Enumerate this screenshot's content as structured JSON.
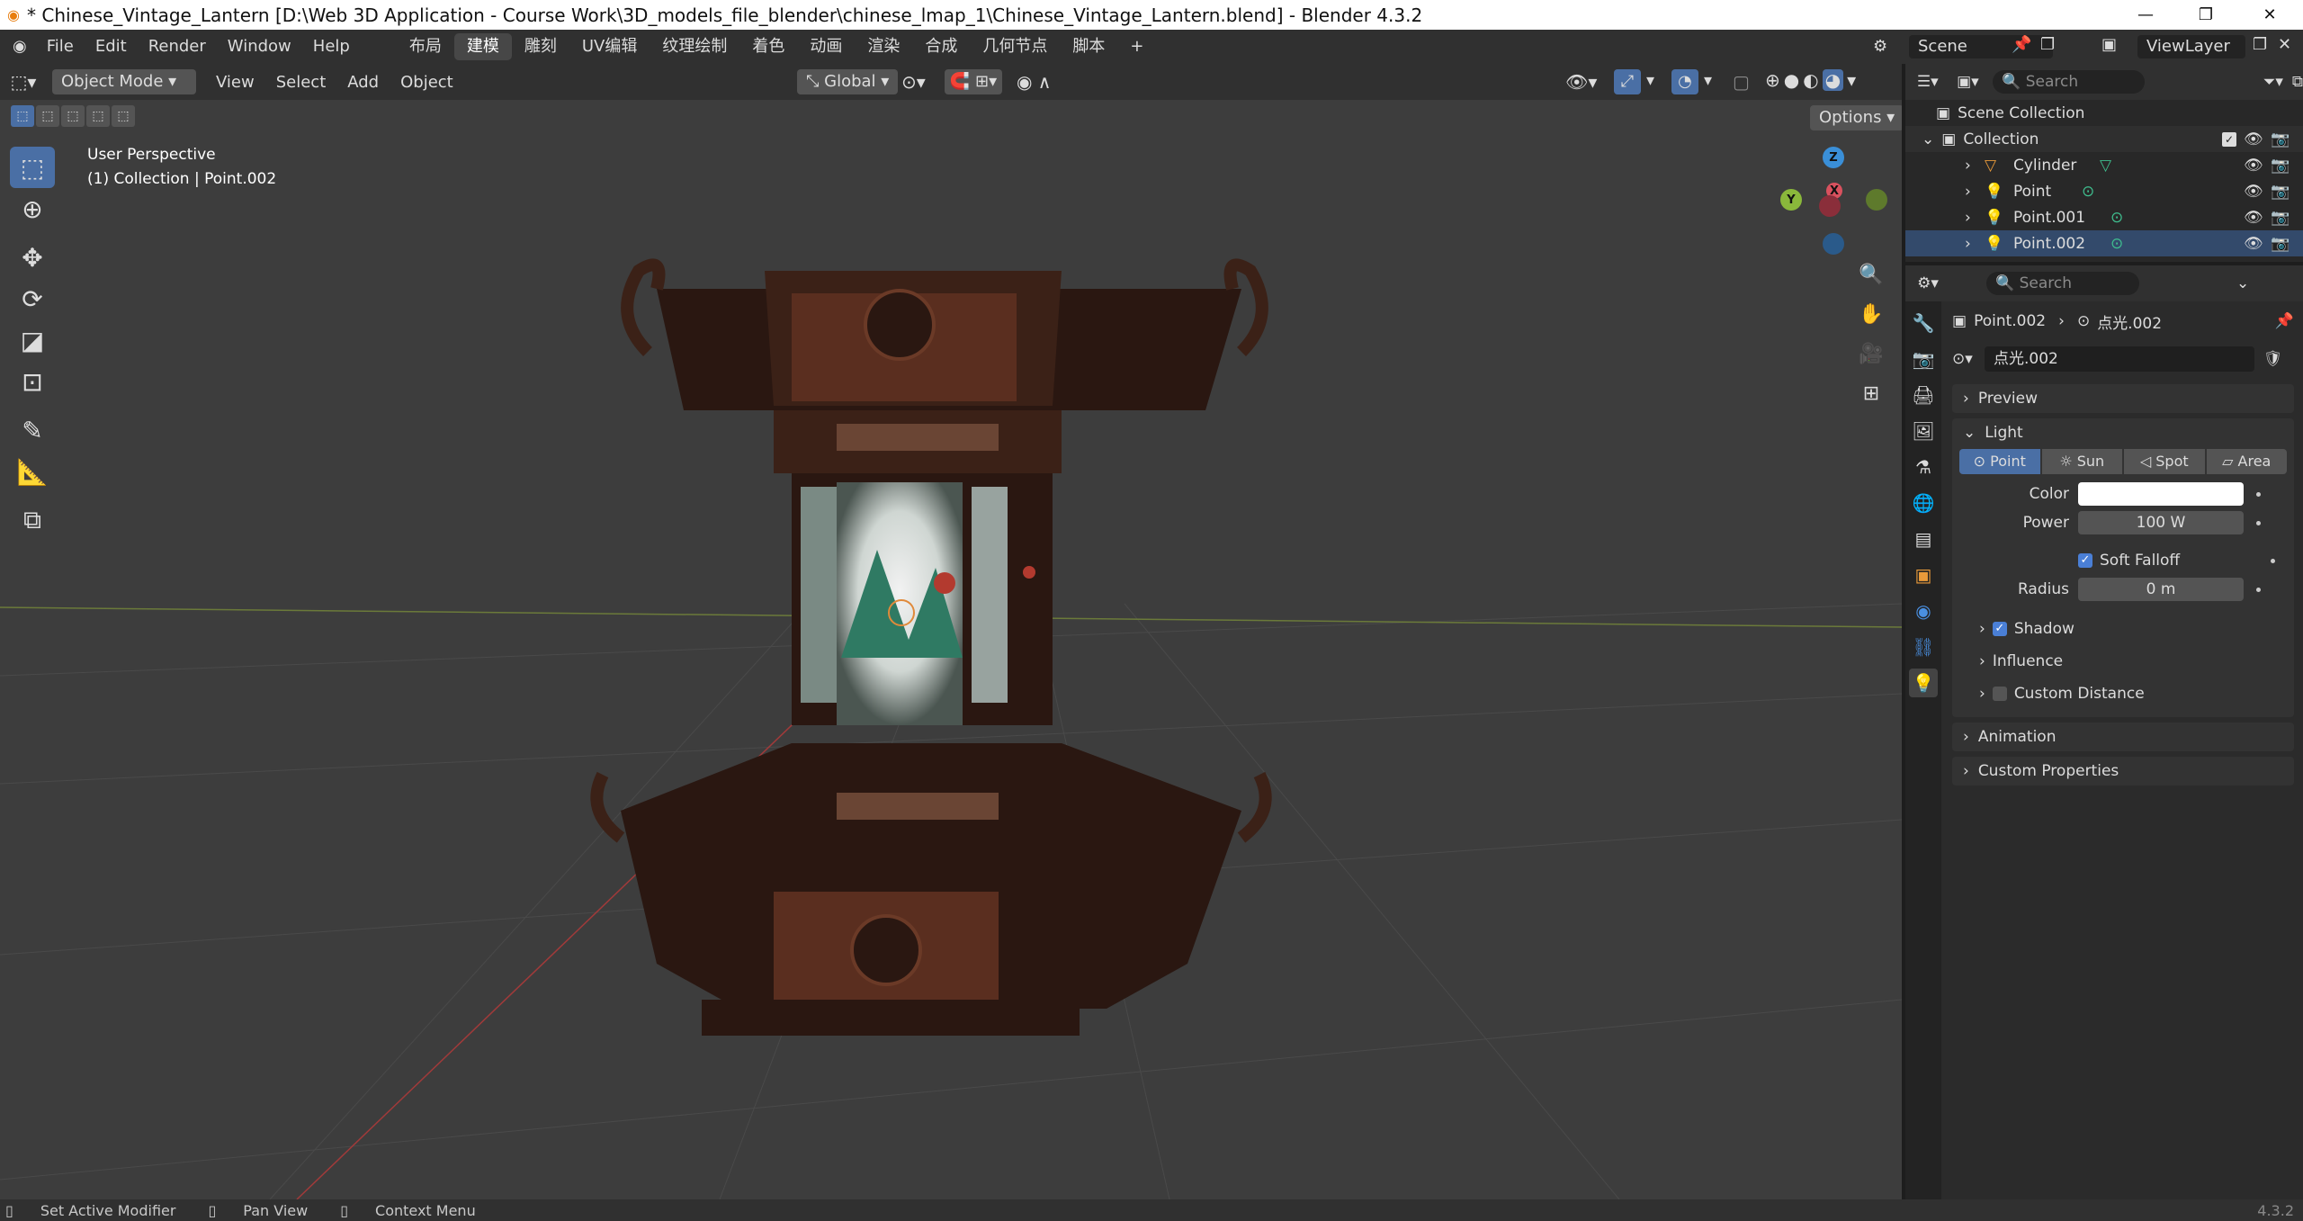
{
  "titlebar": {
    "title": "* Chinese_Vintage_Lantern [D:\\Web 3D Application - Course Work\\3D_models_file_blender\\chinese_lmap_1\\Chinese_Vintage_Lantern.blend] - Blender 4.3.2"
  },
  "menu": {
    "items": [
      "File",
      "Edit",
      "Render",
      "Window",
      "Help"
    ],
    "workspaces": [
      "布局",
      "建模",
      "雕刻",
      "UV编辑",
      "纹理绘制",
      "着色",
      "动画",
      "渲染",
      "合成",
      "几何节点",
      "脚本"
    ],
    "active_workspace": "建模",
    "scene": "Scene",
    "view_layer": "ViewLayer"
  },
  "viewport_header": {
    "mode": "Object Mode",
    "menus": [
      "View",
      "Select",
      "Add",
      "Object"
    ],
    "orientation": "Global",
    "options": "Options"
  },
  "viewport": {
    "line1": "User Perspective",
    "line2": "(1) Collection | Point.002",
    "gizmo": {
      "z": "Z",
      "y": "Y",
      "x": "X"
    }
  },
  "outliner": {
    "search_placeholder": "Search",
    "scene_collection": "Scene Collection",
    "collection": "Collection",
    "items": [
      "Cylinder",
      "Point",
      "Point.001",
      "Point.002"
    ]
  },
  "properties": {
    "search_placeholder": "Search",
    "object": "Point.002",
    "data": "点光.002",
    "datablock": "点光.002",
    "panels": {
      "preview": "Preview",
      "light": "Light",
      "shadow": "Shadow",
      "influence": "Influence",
      "custom_distance": "Custom Distance",
      "animation": "Animation",
      "custom_properties": "Custom Properties"
    },
    "light_types": [
      "Point",
      "Sun",
      "Spot",
      "Area"
    ],
    "active_light_type": "Point",
    "color_label": "Color",
    "color_value": "#ffffff",
    "power_label": "Power",
    "power_value": "100 W",
    "soft_falloff": "Soft Falloff",
    "radius_label": "Radius",
    "radius_value": "0 m"
  },
  "status": {
    "items": [
      "Set Active Modifier",
      "Pan View",
      "Context Menu"
    ],
    "version": "4.3.2"
  },
  "colors": {
    "accent": "#4a6fa5",
    "lantern_wood": "#3b2117",
    "x_axis": "#d9515e",
    "y_axis": "#8ab83b",
    "z_axis": "#3a8fd8"
  }
}
